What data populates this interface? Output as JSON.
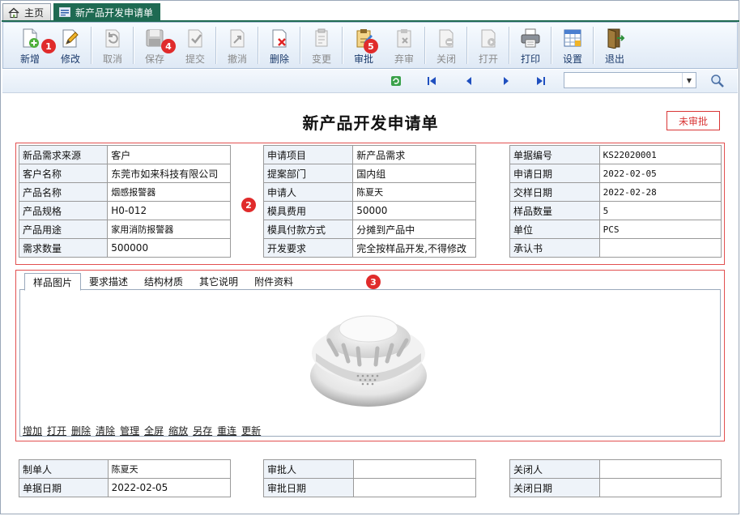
{
  "tabs": {
    "home": "主页",
    "active": "新产品开发申请单"
  },
  "toolbar": [
    {
      "id": "new",
      "label": "新增",
      "disabled": false
    },
    {
      "id": "edit",
      "label": "修改",
      "disabled": false
    },
    {
      "id": "cancel",
      "label": "取消",
      "disabled": true
    },
    {
      "id": "save",
      "label": "保存",
      "disabled": true
    },
    {
      "id": "submit",
      "label": "提交",
      "disabled": true
    },
    {
      "id": "revoke",
      "label": "撤消",
      "disabled": true
    },
    {
      "id": "delete",
      "label": "删除",
      "disabled": false
    },
    {
      "id": "change",
      "label": "变更",
      "disabled": true
    },
    {
      "id": "approve",
      "label": "审批",
      "disabled": false
    },
    {
      "id": "abandon",
      "label": "弃审",
      "disabled": true
    },
    {
      "id": "close",
      "label": "关闭",
      "disabled": true
    },
    {
      "id": "open",
      "label": "打开",
      "disabled": true
    },
    {
      "id": "print",
      "label": "打印",
      "disabled": false
    },
    {
      "id": "settings",
      "label": "设置",
      "disabled": false
    },
    {
      "id": "exit",
      "label": "退出",
      "disabled": false
    }
  ],
  "badges": [
    "1",
    "2",
    "3",
    "4",
    "5"
  ],
  "doc_title": "新产品开发申请单",
  "status": "未审批",
  "form": {
    "col1": [
      [
        "新品需求来源",
        "客户"
      ],
      [
        "客户名称",
        "东莞市如来科技有限公司"
      ],
      [
        "产品名称",
        "烟感报警器"
      ],
      [
        "产品规格",
        "H0-012"
      ],
      [
        "产品用途",
        "家用消防报警器"
      ],
      [
        "需求数量",
        "500000"
      ]
    ],
    "col2": [
      [
        "申请项目",
        "新产品需求"
      ],
      [
        "提案部门",
        "国内组"
      ],
      [
        "申请人",
        "陈夏天"
      ],
      [
        "模具费用",
        "50000"
      ],
      [
        "模具付款方式",
        "分摊到产品中"
      ],
      [
        "开发要求",
        "完全按样品开发,不得修改"
      ]
    ],
    "col3": [
      [
        "单据编号",
        "KS22020001"
      ],
      [
        "申请日期",
        "2022-02-05"
      ],
      [
        "交样日期",
        "2022-02-28"
      ],
      [
        "样品数量",
        "5"
      ],
      [
        "单位",
        "PCS"
      ],
      [
        "承认书",
        ""
      ]
    ]
  },
  "detail_tabs": [
    "样品图片",
    "要求描述",
    "结构材质",
    "其它说明",
    "附件资料"
  ],
  "image_links": [
    "增加",
    "打开",
    "删除",
    "清除",
    "管理",
    "全屏",
    "缩放",
    "另存",
    "重连",
    "更新"
  ],
  "footer": {
    "col1": [
      [
        "制单人",
        "陈夏天"
      ],
      [
        "单据日期",
        "2022-02-05"
      ]
    ],
    "col2": [
      [
        "审批人",
        ""
      ],
      [
        "审批日期",
        ""
      ]
    ],
    "col3": [
      [
        "关闭人",
        ""
      ],
      [
        "关闭日期",
        ""
      ]
    ]
  }
}
